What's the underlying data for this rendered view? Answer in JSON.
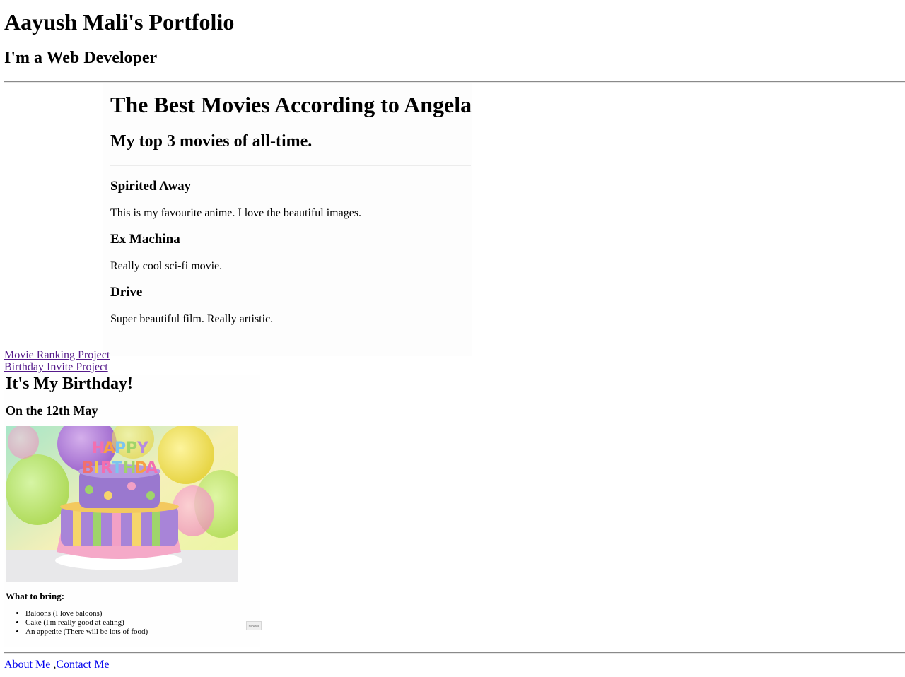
{
  "header": {
    "title": "Aayush Mali's Portfolio",
    "subtitle": "I'm a Web Developer"
  },
  "movie_page": {
    "title": "The Best Movies According to Angela",
    "subtitle": "My top 3 movies of all-time.",
    "movies": [
      {
        "name": "Spirited Away",
        "description": "This is my favourite anime. I love the beautiful images."
      },
      {
        "name": "Ex Machina",
        "description": "Really cool sci-fi movie."
      },
      {
        "name": "Drive",
        "description": "Super beautiful film. Really artistic."
      }
    ]
  },
  "project_links": {
    "movie": "Movie Ranking Project",
    "birthday": "Birthday Invite Project"
  },
  "birthday_page": {
    "title": "It's My Birthday!",
    "date": "On the 12th May",
    "image_text": "HAPPY BIRTHDAY",
    "bring_title": "What to bring:",
    "items": [
      "Baloons (I love baloons)",
      "Cake (I'm really good at eating)",
      "An appetite (There will be lots of food)"
    ],
    "button_label": "Forward"
  },
  "footer": {
    "about": "About Me",
    "separator": " ,",
    "contact": "Contact Me"
  },
  "colors": {
    "visited_link": "#551a8b",
    "link": "#0000ee",
    "rule": "#8a8a8a"
  }
}
